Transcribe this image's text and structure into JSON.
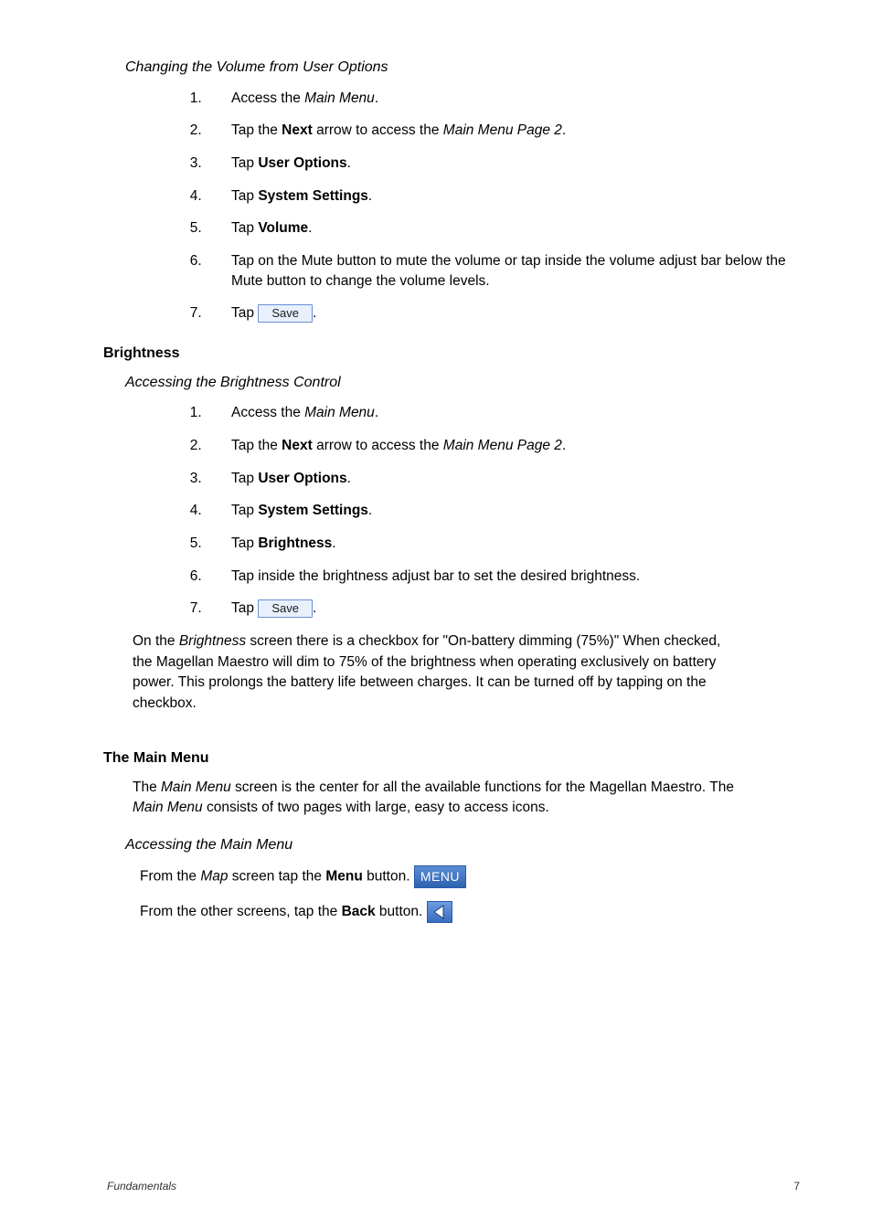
{
  "sec1": {
    "title": "Changing the Volume from User Options",
    "s1a": "Access the ",
    "s1b": "Main Menu",
    "s1c": ".",
    "s2a": "Tap the ",
    "s2b": "Next",
    "s2c": " arrow to access the ",
    "s2d": "Main Menu Page 2",
    "s2e": ".",
    "s3a": "Tap ",
    "s3b": "User Options",
    "s3c": ".",
    "s4a": "Tap ",
    "s4b": "System Settings",
    "s4c": ".",
    "s5a": "Tap ",
    "s5b": "Volume",
    "s5c": ".",
    "s6": "Tap on the Mute button to mute the volume or tap inside the volume adjust bar below the Mute button to change the volume levels.",
    "s7a": "Tap ",
    "s7btn": "Save",
    "s7c": "."
  },
  "brightness_head": "Brightness",
  "sec2": {
    "title": "Accessing the Brightness Control",
    "s1a": "Access the ",
    "s1b": "Main Menu",
    "s1c": ".",
    "s2a": "Tap the ",
    "s2b": "Next",
    "s2c": " arrow to access the ",
    "s2d": "Main Menu Page 2",
    "s2e": ".",
    "s3a": "Tap ",
    "s3b": "User Options",
    "s3c": ".",
    "s4a": "Tap ",
    "s4b": "System Settings",
    "s4c": ".",
    "s5a": "Tap ",
    "s5b": "Brightness",
    "s5c": ".",
    "s6": "Tap inside the brightness adjust bar to set the desired brightness.",
    "s7a": "Tap ",
    "s7btn": "Save",
    "s7c": "."
  },
  "bright_para": {
    "a": "On the ",
    "b": "Brightness",
    "c": " screen there is a checkbox for \"On-battery dimming (75%)\"  When checked, the Magellan Maestro will dim to 75% of the brightness when operating exclusively on battery power.  This prolongs the battery life between charges.  It can be turned off by tapping on the checkbox."
  },
  "mainmenu_head": "The Main Menu",
  "mainmenu_para": {
    "a": "The ",
    "b": "Main Menu",
    "c": " screen is the center for all the available functions for the Magellan Maestro.  The ",
    "d": "Main Menu",
    "e": " consists of two pages with large, easy to access icons."
  },
  "sec3": {
    "title": "Accessing the Main Menu",
    "l1a": "From the ",
    "l1b": "Map",
    "l1c": " screen tap the ",
    "l1d": "Menu",
    "l1e": " button. ",
    "l1btn": "MENU",
    "l2a": "From the other screens, tap the ",
    "l2b": "Back",
    "l2c": " button.  "
  },
  "footer": {
    "left": "Fundamentals",
    "right": "7"
  }
}
